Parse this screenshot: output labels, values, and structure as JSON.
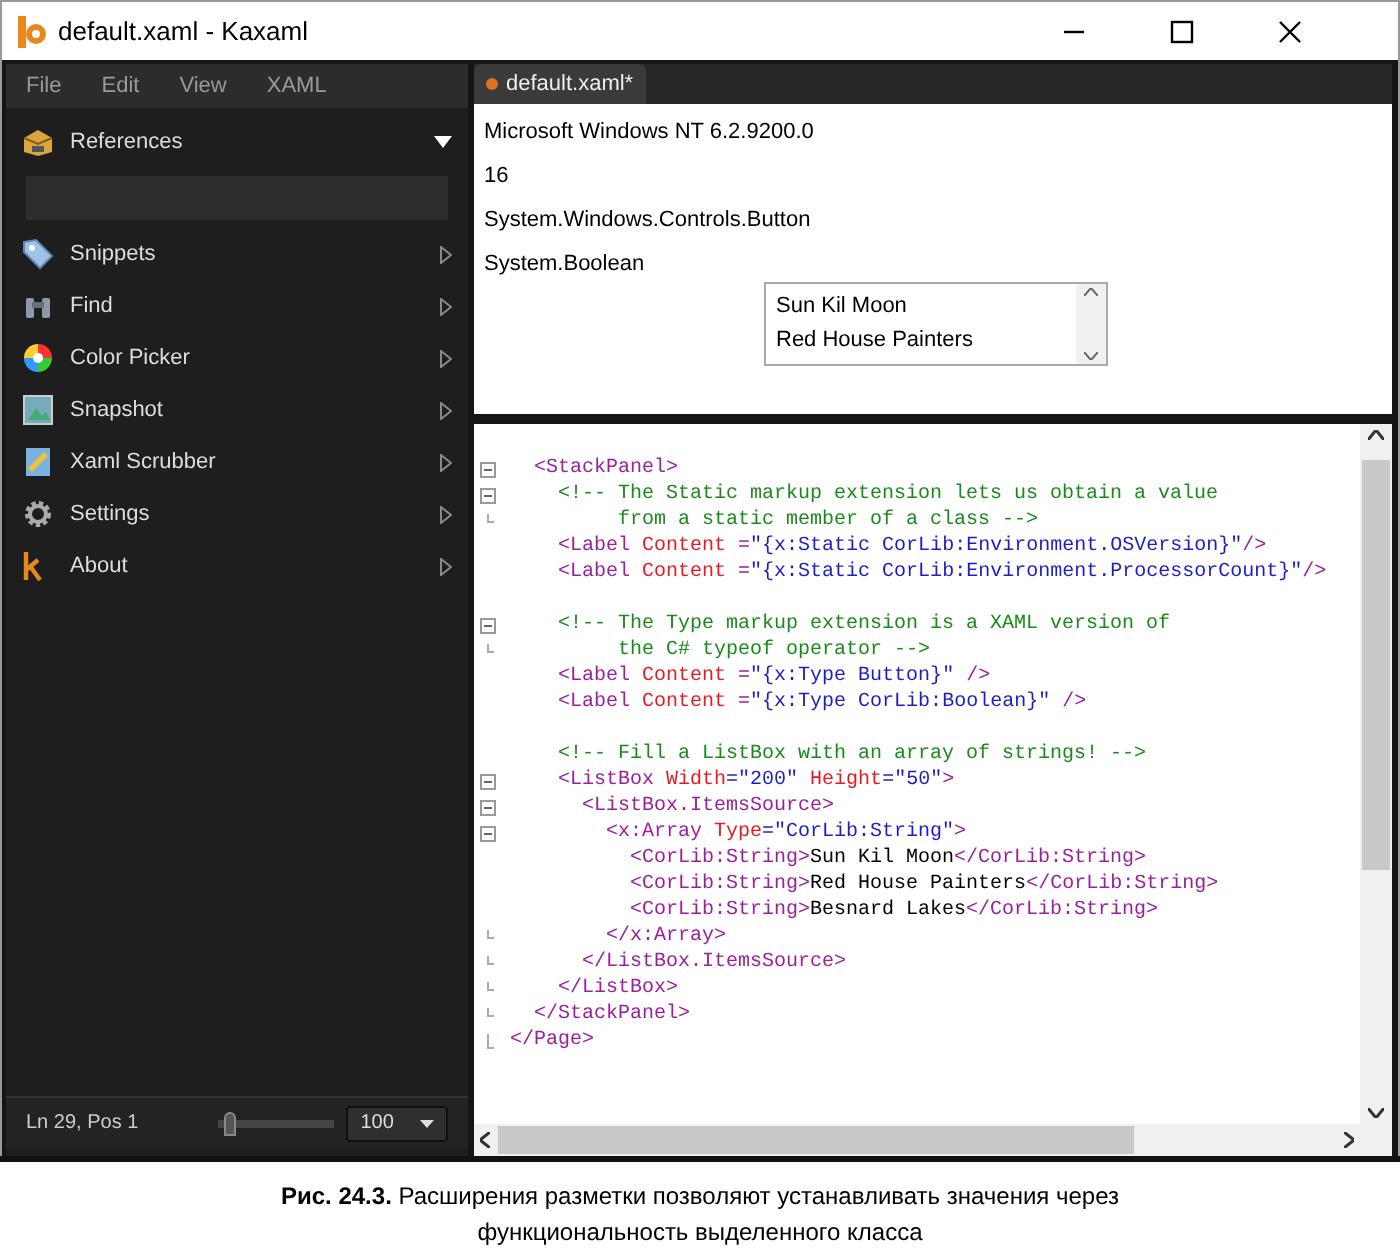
{
  "window": {
    "title": "default.xaml - Kaxaml"
  },
  "menu": [
    "File",
    "Edit",
    "View",
    "XAML"
  ],
  "sidebar": {
    "items": [
      {
        "label": "References",
        "expanded": true
      },
      {
        "label": "Snippets",
        "expanded": false
      },
      {
        "label": "Find",
        "expanded": false
      },
      {
        "label": "Color Picker",
        "expanded": false
      },
      {
        "label": "Snapshot",
        "expanded": false
      },
      {
        "label": "Xaml Scrubber",
        "expanded": false
      },
      {
        "label": "Settings",
        "expanded": false
      },
      {
        "label": "About",
        "expanded": false
      }
    ]
  },
  "status_bar": {
    "position": "Ln 29, Pos 1",
    "zoom_slider": {
      "level": 0.05
    },
    "zoom": "100"
  },
  "tabs": [
    {
      "label": "default.xaml*",
      "selected": true,
      "modified": true
    }
  ],
  "preview": {
    "labels": [
      "Microsoft Windows NT 6.2.9200.0",
      "16",
      "System.Windows.Controls.Button",
      "System.Boolean"
    ],
    "listbox": [
      "Sun Kil Moon",
      "Red House Painters"
    ]
  },
  "editor": {
    "lines": [
      {
        "kind": "collapse",
        "tokens": [
          {
            "kind": "tag",
            "text": "  <StackPanel>"
          }
        ]
      },
      {
        "kind": "collapse",
        "tokens": [
          {
            "kind": "comment",
            "text": "    <!-- The Static markup extension lets us obtain a value"
          }
        ]
      },
      {
        "kind": "branch",
        "tokens": [
          {
            "kind": "comment",
            "text": "         from a static member of a class -->"
          }
        ]
      },
      {
        "kind": "plain",
        "tokens": [
          {
            "kind": "tag",
            "text": "    <Label"
          },
          {
            "kind": "attr",
            "text": " Content"
          },
          {
            "kind": "tag",
            "text": " ="
          },
          {
            "kind": "value",
            "text": "\"{x:Static CorLib:Environment.OSVersion}\""
          },
          {
            "kind": "tag",
            "text": "/>"
          }
        ]
      },
      {
        "kind": "plain",
        "tokens": [
          {
            "kind": "tag",
            "text": "    <Label"
          },
          {
            "kind": "attr",
            "text": " Content"
          },
          {
            "kind": "tag",
            "text": " ="
          },
          {
            "kind": "value",
            "text": "\"{x:Static CorLib:Environment.ProcessorCount}\""
          },
          {
            "kind": "tag",
            "text": "/>"
          }
        ]
      },
      {
        "kind": "blank"
      },
      {
        "kind": "collapse",
        "tokens": [
          {
            "kind": "comment",
            "text": "    <!-- The Type markup extension is a XAML version of"
          }
        ]
      },
      {
        "kind": "branch",
        "tokens": [
          {
            "kind": "comment",
            "text": "         the C# typeof operator -->"
          }
        ]
      },
      {
        "kind": "plain",
        "tokens": [
          {
            "kind": "tag",
            "text": "    <Label"
          },
          {
            "kind": "attr",
            "text": " Content"
          },
          {
            "kind": "tag",
            "text": " ="
          },
          {
            "kind": "value",
            "text": "\"{x:Type Button}\""
          },
          {
            "kind": "tag",
            "text": " />"
          }
        ]
      },
      {
        "kind": "plain",
        "tokens": [
          {
            "kind": "tag",
            "text": "    <Label"
          },
          {
            "kind": "attr",
            "text": " Content"
          },
          {
            "kind": "tag",
            "text": " ="
          },
          {
            "kind": "value",
            "text": "\"{x:Type CorLib:Boolean}\""
          },
          {
            "kind": "tag",
            "text": " />"
          }
        ]
      },
      {
        "kind": "blank"
      },
      {
        "kind": "plain",
        "tokens": [
          {
            "kind": "comment",
            "text": "    <!-- Fill a ListBox with an array of strings! -->"
          }
        ]
      },
      {
        "kind": "collapse",
        "tokens": [
          {
            "kind": "tag",
            "text": "    <ListBox"
          },
          {
            "kind": "attr",
            "text": " Width"
          },
          {
            "kind": "value",
            "text": "=\"200\""
          },
          {
            "kind": "attr",
            "text": " Height"
          },
          {
            "kind": "value",
            "text": "=\"50\""
          },
          {
            "kind": "tag",
            "text": ">"
          }
        ]
      },
      {
        "kind": "collapse",
        "tokens": [
          {
            "kind": "tag",
            "text": "      <ListBox.ItemsSource>"
          }
        ]
      },
      {
        "kind": "collapse",
        "tokens": [
          {
            "kind": "tag",
            "text": "        <x:Array"
          },
          {
            "kind": "attr",
            "text": " Type"
          },
          {
            "kind": "value",
            "text": "=\"CorLib:String\""
          },
          {
            "kind": "tag",
            "text": ">"
          }
        ]
      },
      {
        "kind": "plain",
        "tokens": [
          {
            "kind": "tag",
            "text": "          <CorLib:String>"
          },
          {
            "kind": "text",
            "text": "Sun Kil Moon"
          },
          {
            "kind": "tag",
            "text": "</CorLib:String>"
          }
        ]
      },
      {
        "kind": "plain",
        "tokens": [
          {
            "kind": "tag",
            "text": "          <CorLib:String>"
          },
          {
            "kind": "text",
            "text": "Red House Painters"
          },
          {
            "kind": "tag",
            "text": "</CorLib:String>"
          }
        ]
      },
      {
        "kind": "plain",
        "tokens": [
          {
            "kind": "tag",
            "text": "          <CorLib:String>"
          },
          {
            "kind": "text",
            "text": "Besnard Lakes"
          },
          {
            "kind": "tag",
            "text": "</CorLib:String>"
          }
        ]
      },
      {
        "kind": "branch",
        "tokens": [
          {
            "kind": "tag",
            "text": "        </x:Array>"
          }
        ]
      },
      {
        "kind": "branch",
        "tokens": [
          {
            "kind": "tag",
            "text": "      </ListBox.ItemsSource>"
          }
        ]
      },
      {
        "kind": "branch",
        "tokens": [
          {
            "kind": "tag",
            "text": "    </ListBox>"
          }
        ]
      },
      {
        "kind": "branch",
        "tokens": [
          {
            "kind": "tag",
            "text": "  </StackPanel>"
          }
        ]
      },
      {
        "kind": "end",
        "tokens": [
          {
            "kind": "tag",
            "text": "</Page>"
          }
        ]
      }
    ]
  },
  "caption": "**Рис. 24.3.** Расширения разметки позволяют устанавливать значения через функциональность выделенного класса"
}
